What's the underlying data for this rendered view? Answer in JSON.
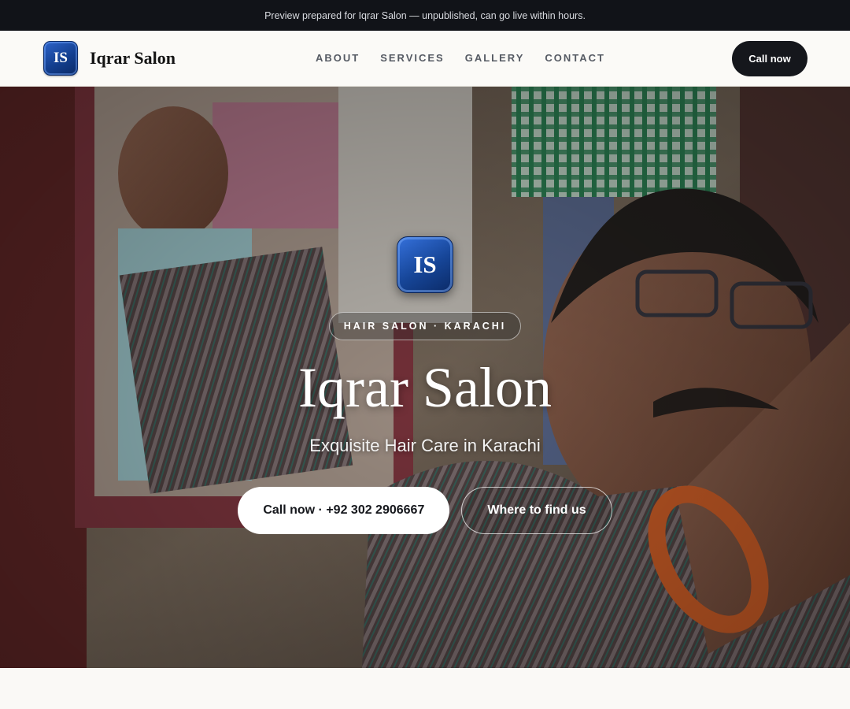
{
  "preview_banner": "Preview prepared for Iqrar Salon — unpublished, can go live within hours.",
  "header": {
    "logo_initials": "IS",
    "brand_name": "Iqrar Salon",
    "nav": [
      {
        "label": "ABOUT"
      },
      {
        "label": "SERVICES"
      },
      {
        "label": "GALLERY"
      },
      {
        "label": "CONTACT"
      }
    ],
    "cta_label": "Call now"
  },
  "hero": {
    "logo_initials": "IS",
    "tag": "HAIR SALON · KARACHI",
    "title": "Iqrar Salon",
    "subtitle": "Exquisite Hair Care in Karachi",
    "primary_button": "Call now · +92 302 2906667",
    "secondary_button": "Where to find us"
  },
  "colors": {
    "banner_bg": "#111318",
    "logo_blue": "#164597",
    "cta_dark": "#15171c",
    "page_bg": "#faf9f6"
  }
}
